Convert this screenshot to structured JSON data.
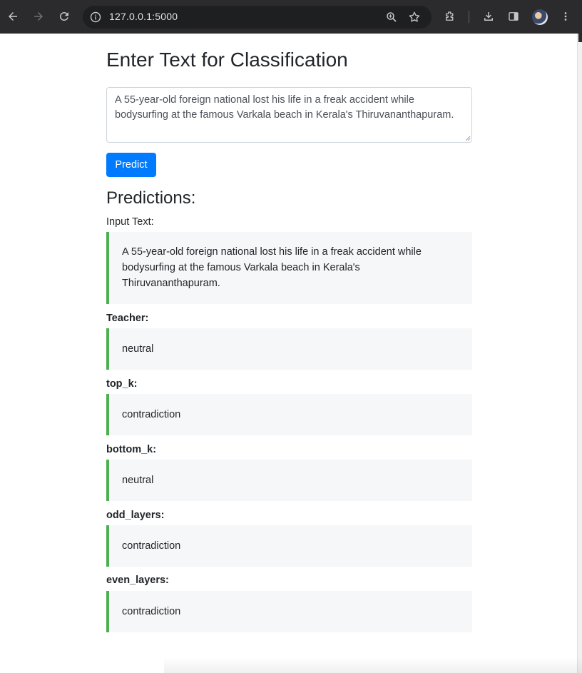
{
  "browser": {
    "url": "127.0.0.1:5000",
    "icons": [
      "back-icon",
      "forward-icon",
      "reload-icon",
      "info-icon",
      "zoom-icon",
      "star-icon",
      "extensions-icon",
      "download-icon",
      "side-panel-icon",
      "avatar",
      "more-icon"
    ]
  },
  "page": {
    "title": "Enter Text for Classification",
    "input_value": "A 55-year-old foreign national lost his life in a freak accident while bodysurfing at the famous Varkala beach in Kerala's Thiruvananthapuram.",
    "predict_label": "Predict",
    "predictions_heading": "Predictions:",
    "input_text_label": "Input Text:",
    "input_text_value": "A 55-year-old foreign national lost his life in a freak accident while bodysurfing at the famous Varkala beach in Kerala's Thiruvananthapuram.",
    "results": [
      {
        "label": "Teacher:",
        "value": "neutral"
      },
      {
        "label": "top_k:",
        "value": "contradiction"
      },
      {
        "label": "bottom_k:",
        "value": "neutral"
      },
      {
        "label": "odd_layers:",
        "value": "contradiction"
      },
      {
        "label": "even_layers:",
        "value": "contradiction"
      }
    ]
  },
  "colors": {
    "accent": "#007bff",
    "result_border": "#4caf50",
    "result_bg": "#f6f7f9"
  }
}
